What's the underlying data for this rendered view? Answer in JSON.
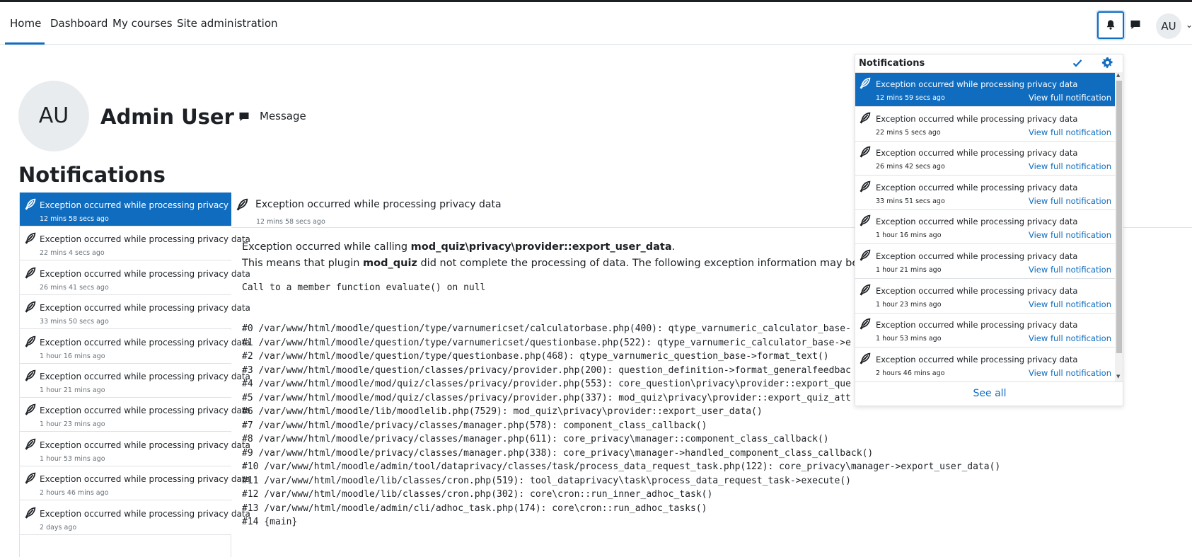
{
  "nav": {
    "items": [
      "Home",
      "Dashboard",
      "My courses",
      "Site administration"
    ],
    "avatar_initials": "AU"
  },
  "profile": {
    "initials": "AU",
    "name": "Admin User",
    "message_label": "Message"
  },
  "page_title": "Notifications",
  "notifications": [
    {
      "subject": "Exception occurred while processing privacy data",
      "list_time": "12 mins 58 secs ago",
      "popover_time": "12 mins 59 secs ago"
    },
    {
      "subject": "Exception occurred while processing privacy data",
      "list_time": "22 mins 4 secs ago",
      "popover_time": "22 mins 5 secs ago"
    },
    {
      "subject": "Exception occurred while processing privacy data",
      "list_time": "26 mins 41 secs ago",
      "popover_time": "26 mins 42 secs ago"
    },
    {
      "subject": "Exception occurred while processing privacy data",
      "list_time": "33 mins 50 secs ago",
      "popover_time": "33 mins 51 secs ago"
    },
    {
      "subject": "Exception occurred while processing privacy data",
      "list_time": "1 hour 16 mins ago",
      "popover_time": "1 hour 16 mins ago"
    },
    {
      "subject": "Exception occurred while processing privacy data",
      "list_time": "1 hour 21 mins ago",
      "popover_time": "1 hour 21 mins ago"
    },
    {
      "subject": "Exception occurred while processing privacy data",
      "list_time": "1 hour 23 mins ago",
      "popover_time": "1 hour 23 mins ago"
    },
    {
      "subject": "Exception occurred while processing privacy data",
      "list_time": "1 hour 53 mins ago",
      "popover_time": "1 hour 53 mins ago"
    },
    {
      "subject": "Exception occurred while processing privacy data",
      "list_time": "2 hours 46 mins ago",
      "popover_time": "2 hours 46 mins ago"
    },
    {
      "subject": "Exception occurred while processing privacy data",
      "list_time": "2 days ago",
      "popover_time": null
    }
  ],
  "detail": {
    "subject": "Exception occurred while processing privacy data",
    "time": "12 mins 58 secs ago",
    "line1_pre": "Exception occurred while calling ",
    "line1_bold": "mod_quiz\\privacy\\provider::export_user_data",
    "line1_post": ".",
    "line2_pre": "This means that plugin ",
    "line2_bold": "mod_quiz",
    "line2_post": " did not complete the processing of data. The following exception information may be passed on",
    "error": "Call to a member function evaluate() on null",
    "trace": [
      "#0 /var/www/html/moodle/question/type/varnumericset/calculatorbase.php(400): qtype_varnumeric_calculator_base-",
      "#1 /var/www/html/moodle/question/type/varnumericset/questionbase.php(522): qtype_varnumeric_calculator_base->e",
      "#2 /var/www/html/moodle/question/type/questionbase.php(468): qtype_varnumeric_question_base->format_text()",
      "#3 /var/www/html/moodle/question/classes/privacy/provider.php(200): question_definition->format_generalfeedbac",
      "#4 /var/www/html/moodle/mod/quiz/classes/privacy/provider.php(553): core_question\\privacy\\provider::export_que",
      "#5 /var/www/html/moodle/mod/quiz/classes/privacy/provider.php(337): mod_quiz\\privacy\\provider::export_quiz_att",
      "#6 /var/www/html/moodle/lib/moodlelib.php(7529): mod_quiz\\privacy\\provider::export_user_data()",
      "#7 /var/www/html/moodle/privacy/classes/manager.php(578): component_class_callback()",
      "#8 /var/www/html/moodle/privacy/classes/manager.php(611): core_privacy\\manager::component_class_callback()",
      "#9 /var/www/html/moodle/privacy/classes/manager.php(338): core_privacy\\manager->handled_component_class_callback()",
      "#10 /var/www/html/moodle/admin/tool/dataprivacy/classes/task/process_data_request_task.php(122): core_privacy\\manager->export_user_data()",
      "#11 /var/www/html/moodle/lib/classes/cron.php(519): tool_dataprivacy\\task\\process_data_request_task->execute()",
      "#12 /var/www/html/moodle/lib/classes/cron.php(302): core\\cron::run_inner_adhoc_task()",
      "#13 /var/www/html/moodle/admin/cli/adhoc_task.php(174): core\\cron::run_adhoc_tasks()",
      "#14 {main}"
    ]
  },
  "popover": {
    "title": "Notifications",
    "view_label": "View full notification",
    "see_all": "See all"
  },
  "colors": {
    "accent": "#0f6cbf",
    "muted": "#6a737b",
    "border": "#dee2e6"
  },
  "icons": {
    "notification": "feather-icon",
    "bell": "bell-icon",
    "message": "message-icon",
    "mark_read": "check-icon",
    "settings": "gear-icon"
  }
}
